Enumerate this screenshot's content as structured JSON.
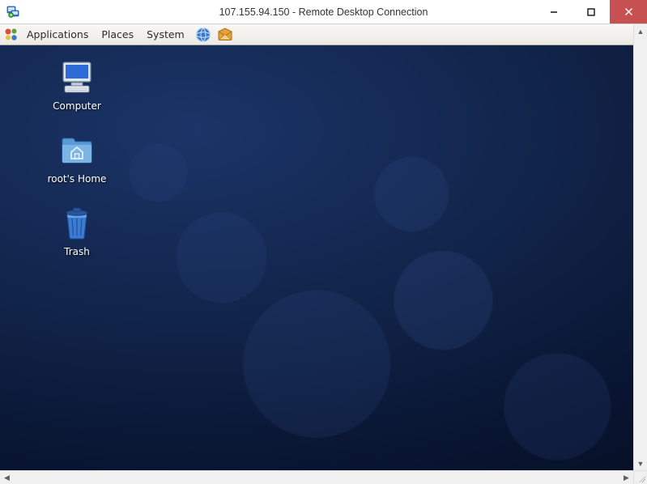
{
  "window": {
    "title": "107.155.94.150 - Remote Desktop Connection"
  },
  "panel": {
    "menus": [
      "Applications",
      "Places",
      "System"
    ]
  },
  "desktop": {
    "icons": [
      {
        "id": "computer",
        "label": "Computer"
      },
      {
        "id": "home",
        "label": "root's Home"
      },
      {
        "id": "trash",
        "label": "Trash"
      }
    ]
  }
}
